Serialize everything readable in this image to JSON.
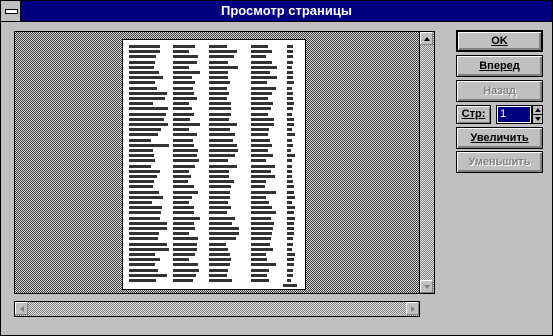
{
  "window": {
    "title": "Просмотр страницы"
  },
  "buttons": {
    "ok_label": "OK",
    "forward_label": "Вперед",
    "back_label": "Назад",
    "zoom_in_label": "Увеличить",
    "zoom_out_label": "Уменьшить"
  },
  "page_control": {
    "label": "Стр:",
    "value": "1"
  },
  "icons": {
    "system_menu": "system-menu-icon",
    "scroll_up": "arrow-up-icon",
    "scroll_down": "arrow-down-icon",
    "scroll_left": "arrow-left-icon",
    "scroll_right": "arrow-right-icon"
  },
  "colors": {
    "titlebar": "#000080",
    "face": "#c0c0c0",
    "selection": "#000080"
  }
}
